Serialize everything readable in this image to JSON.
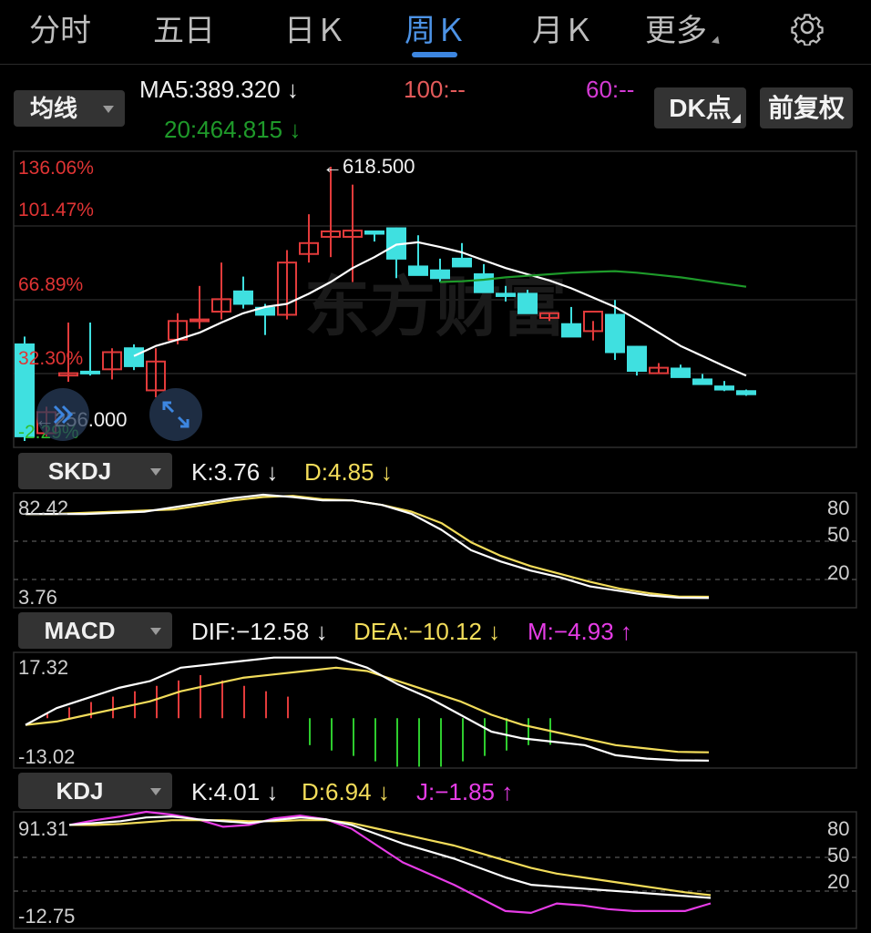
{
  "tabs": [
    {
      "label": "分时",
      "active": false
    },
    {
      "label": "五日",
      "active": false
    },
    {
      "label": "日Ｋ",
      "active": false
    },
    {
      "label": "周Ｋ",
      "active": true
    },
    {
      "label": "月Ｋ",
      "active": false
    },
    {
      "label": "更多",
      "active": false
    }
  ],
  "settings_icon": "gear-icon",
  "main_indicator": {
    "selector": "均线",
    "ma5": "MA5:389.320 ↓",
    "ma20": "20:464.815 ↓",
    "ma100": "100:--",
    "ma60": "60:--",
    "dk_button": "DK点",
    "adjust_button": "前复权"
  },
  "watermark": "东方财富",
  "colors": {
    "up": "#e23b3b",
    "down": "#3fe0e0",
    "ma5": "#ffffff",
    "ma20": "#1e9a2a",
    "yellow": "#f2dc5a",
    "magenta": "#e63ce6",
    "green_bar": "#2ecc2e",
    "accent": "#3d86e0"
  },
  "price_axis": {
    "pct_labels": [
      "136.06%",
      "101.47%",
      "66.89%",
      "32.30%",
      "-2.29%"
    ],
    "high_label": "618.500",
    "low_label": "256.000"
  },
  "overlay_buttons": [
    {
      "icon": "double-chevron-right-icon"
    },
    {
      "icon": "expand-arrows-icon"
    }
  ],
  "skdj": {
    "selector": "SKDJ",
    "k": "K:3.76 ↓",
    "d": "D:4.85 ↓",
    "max": "82.42",
    "min": "3.76",
    "levels": [
      "80",
      "50",
      "20"
    ]
  },
  "macd": {
    "selector": "MACD",
    "dif": "DIF:−12.58 ↓",
    "dea": "DEA:−10.12 ↓",
    "m": "M:−4.93 ↑",
    "max": "17.32",
    "min": "-13.02"
  },
  "kdj": {
    "selector": "KDJ",
    "k": "K:4.01 ↓",
    "d": "D:6.94 ↓",
    "j": "J:−1.85 ↑",
    "max": "91.31",
    "min": "-12.75",
    "levels": [
      "80",
      "50",
      "20"
    ]
  },
  "chart_data": {
    "type": "candlestick",
    "price_range": [
      256.0,
      618.5
    ],
    "candles": [
      {
        "o": 380,
        "h": 390,
        "l": 256,
        "c": 262
      },
      {
        "o": 266,
        "h": 300,
        "l": 262,
        "c": 293
      },
      {
        "o": 340,
        "h": 408,
        "l": 332,
        "c": 343
      },
      {
        "o": 345,
        "h": 408,
        "l": 340,
        "c": 344
      },
      {
        "o": 348,
        "h": 375,
        "l": 335,
        "c": 370
      },
      {
        "o": 375,
        "h": 380,
        "l": 347,
        "c": 352
      },
      {
        "o": 321,
        "h": 375,
        "l": 312,
        "c": 358
      },
      {
        "o": 386,
        "h": 420,
        "l": 380,
        "c": 410
      },
      {
        "o": 410,
        "h": 455,
        "l": 400,
        "c": 412
      },
      {
        "o": 422,
        "h": 485,
        "l": 412,
        "c": 438
      },
      {
        "o": 448,
        "h": 467,
        "l": 426,
        "c": 432
      },
      {
        "o": 427,
        "h": 432,
        "l": 392,
        "c": 418
      },
      {
        "o": 418,
        "h": 501,
        "l": 412,
        "c": 485
      },
      {
        "o": 496,
        "h": 547,
        "l": 485,
        "c": 510
      },
      {
        "o": 518,
        "h": 608,
        "l": 492,
        "c": 525
      },
      {
        "o": 518,
        "h": 585,
        "l": 460,
        "c": 526
      },
      {
        "o": 525,
        "h": 522,
        "l": 512,
        "c": 522
      },
      {
        "o": 529,
        "h": 530,
        "l": 465,
        "c": 490
      },
      {
        "o": 480,
        "h": 520,
        "l": 472,
        "c": 469
      },
      {
        "o": 475,
        "h": 490,
        "l": 460,
        "c": 465
      },
      {
        "o": 490,
        "h": 510,
        "l": 483,
        "c": 480
      },
      {
        "o": 470,
        "h": 483,
        "l": 452,
        "c": 447
      },
      {
        "o": 445,
        "h": 455,
        "l": 435,
        "c": 442
      },
      {
        "o": 445,
        "h": 450,
        "l": 420,
        "c": 420
      },
      {
        "o": 414,
        "h": 420,
        "l": 410,
        "c": 420
      },
      {
        "o": 406,
        "h": 428,
        "l": 397,
        "c": 390
      },
      {
        "o": 397,
        "h": 410,
        "l": 385,
        "c": 422
      },
      {
        "o": 418,
        "h": 437,
        "l": 360,
        "c": 370
      },
      {
        "o": 377,
        "h": 378,
        "l": 340,
        "c": 346
      },
      {
        "o": 343,
        "h": 356,
        "l": 342,
        "c": 350
      },
      {
        "o": 349,
        "h": 354,
        "l": 338,
        "c": 338
      },
      {
        "o": 335,
        "h": 342,
        "l": 328,
        "c": 329
      },
      {
        "o": 326,
        "h": 333,
        "l": 320,
        "c": 322
      },
      {
        "o": 320,
        "h": 322,
        "l": 314,
        "c": 316
      }
    ],
    "ma5": [
      null,
      null,
      null,
      null,
      null,
      365,
      378,
      386,
      395,
      408,
      420,
      428,
      432,
      445,
      460,
      478,
      492,
      508,
      511,
      505,
      498,
      488,
      478,
      470,
      462,
      452,
      440,
      428,
      412,
      395,
      378,
      365,
      352,
      340
    ],
    "ma20": [
      null,
      null,
      null,
      null,
      null,
      null,
      null,
      null,
      null,
      null,
      null,
      null,
      null,
      null,
      null,
      null,
      null,
      null,
      null,
      460,
      461,
      463,
      466,
      468,
      470,
      472,
      473,
      474,
      472,
      469,
      466,
      462,
      458,
      454
    ],
    "skdj": {
      "k": [
        78,
        78,
        78,
        79,
        80,
        84,
        88,
        92,
        95,
        93,
        90,
        90,
        86,
        78,
        64,
        46,
        36,
        28,
        22,
        14,
        10,
        6,
        4,
        3.76
      ],
      "d": [
        78,
        78,
        79,
        80,
        81,
        82,
        86,
        90,
        93,
        94,
        91,
        90,
        86,
        80,
        70,
        53,
        41,
        32,
        25,
        18,
        12,
        8,
        5,
        4.85
      ]
    },
    "macd": {
      "dif": [
        -2,
        3,
        6,
        9,
        11,
        15,
        16,
        17,
        18,
        18,
        18,
        15,
        10,
        6,
        1,
        -4,
        -6,
        -7,
        -8,
        -11,
        -12,
        -12.5,
        -12.58
      ],
      "dea": [
        -2,
        -1,
        1,
        3,
        5,
        8,
        10,
        12,
        13,
        14,
        15,
        14,
        11,
        8,
        5,
        1,
        -2,
        -4,
        -6,
        -8,
        -9,
        -10,
        -10.12
      ],
      "m": [
        1,
        2,
        3,
        4,
        5,
        6,
        7,
        8,
        7,
        6,
        5,
        4,
        -5,
        -6,
        -7,
        -8,
        -9,
        -9,
        -9,
        -8,
        -7,
        -6,
        -5,
        -4.93
      ]
    },
    "kdj": {
      "k": [
        82,
        84,
        86,
        90,
        91,
        88,
        86,
        84,
        87,
        90,
        88,
        82,
        72,
        62,
        54,
        46,
        36,
        26,
        18,
        16,
        14,
        12,
        10,
        8,
        6,
        4.01
      ],
      "d": [
        82,
        82,
        83,
        85,
        87,
        87,
        87,
        86,
        86,
        87,
        87,
        84,
        78,
        72,
        66,
        60,
        52,
        44,
        36,
        30,
        26,
        22,
        18,
        14,
        10,
        6.94
      ],
      "j": [
        82,
        87,
        91,
        96,
        93,
        88,
        80,
        82,
        89,
        92,
        88,
        78,
        60,
        42,
        30,
        18,
        4,
        -10,
        -12,
        -2,
        -4,
        -8,
        -10,
        -10,
        -10,
        -1.85
      ]
    }
  }
}
